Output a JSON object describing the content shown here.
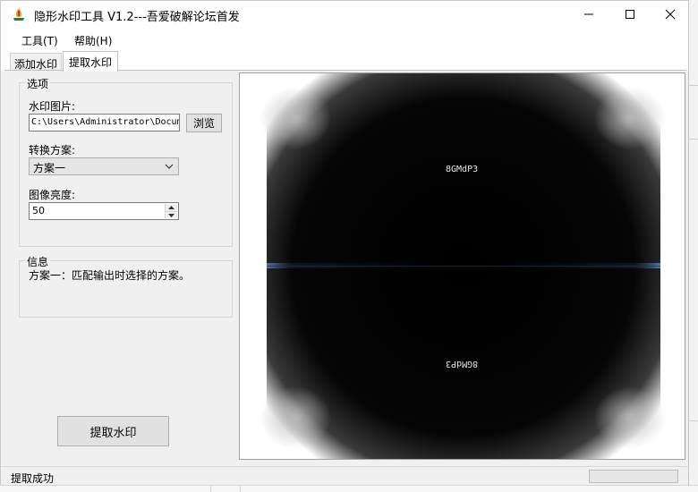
{
  "window": {
    "title": "隐形水印工具 V1.2---吾爱破解论坛首发",
    "controls": {
      "minimize": "minimize-icon",
      "maximize": "maximize-icon",
      "close": "close-icon"
    }
  },
  "menu": {
    "items": [
      "工具(T)",
      "帮助(H)"
    ]
  },
  "tabs": [
    {
      "label": "添加水印",
      "active": false
    },
    {
      "label": "提取水印",
      "active": true
    }
  ],
  "options": {
    "group_title": "选项",
    "watermark_image_label": "水印图片:",
    "watermark_image_path": "C:\\Users\\Administrator\\Documents",
    "browse_label": "浏览",
    "scheme_label": "转换方案:",
    "scheme_selected": "方案一",
    "brightness_label": "图像亮度:",
    "brightness_value": "50"
  },
  "info": {
    "group_title": "信息",
    "text": "方案一：匹配输出时选择的方案。"
  },
  "extract_button": "提取水印",
  "preview": {
    "watermark_text_top": "8GMdP3",
    "watermark_text_bottom": "8GMdP3"
  },
  "status": {
    "text": "提取成功",
    "progress_fraction": 0
  },
  "colors": {
    "window_bg": "#f0f0f0",
    "panel_border": "#a0a0a0",
    "progress_fill": "#06b025"
  }
}
